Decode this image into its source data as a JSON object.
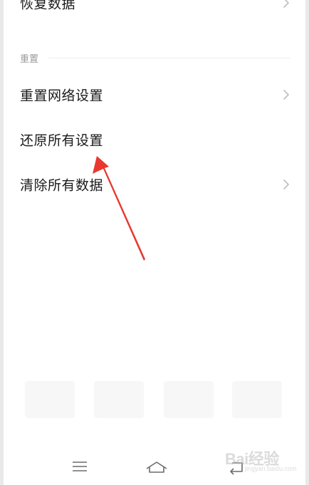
{
  "settings": {
    "partial_top_item": {
      "label": "恢复数据"
    },
    "reset_section": {
      "title": "重置",
      "items": [
        {
          "label": "重置网络设置"
        },
        {
          "label": "还原所有设置"
        },
        {
          "label": "清除所有数据"
        }
      ]
    }
  },
  "annotation": {
    "arrow_color": "#e8382f"
  },
  "watermark": {
    "text": "Bai经验",
    "sub": "jingyan.baidu.com"
  },
  "icons": {
    "chevron": "chevron-right-icon",
    "nav_menu": "menu-icon",
    "nav_home": "home-icon",
    "nav_back": "back-icon"
  }
}
